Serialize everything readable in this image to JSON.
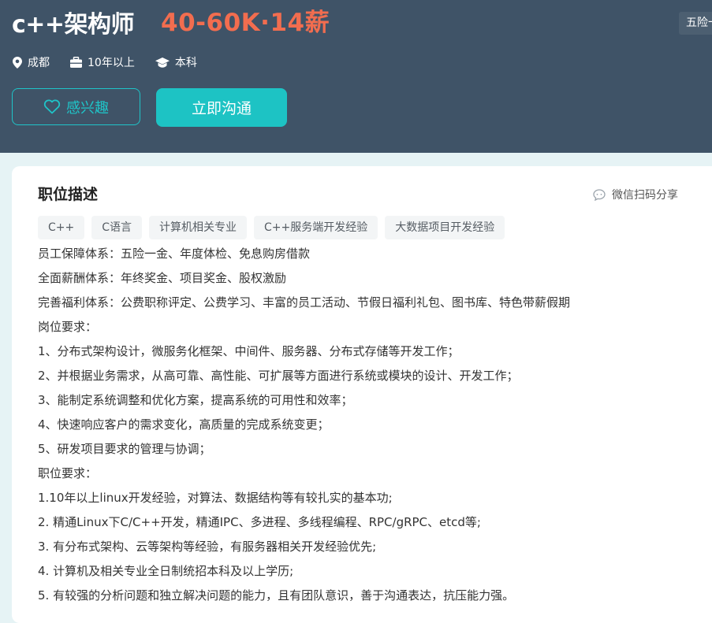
{
  "header": {
    "job_title": "c++架构师",
    "salary": "40-60K·14薪",
    "benefit_chip": "五险一金",
    "meta": {
      "location": "成都",
      "experience": "10年以上",
      "education": "本科"
    },
    "interest_button": "感兴趣",
    "chat_button": "立即沟通"
  },
  "colors": {
    "header_bg": "#3f5367",
    "salary": "#f26d4f",
    "accent": "#1dc3c4"
  },
  "icons": {
    "location": "location-pin-icon",
    "experience": "briefcase-icon",
    "education": "graduation-cap-icon",
    "interest": "heart-outline-icon",
    "share": "chat-bubble-icon"
  },
  "description": {
    "title": "职位描述",
    "share_label": "微信扫码分享",
    "tags": [
      "C++",
      "C语言",
      "计算机相关专业",
      "C++服务端开发经验",
      "大数据项目开发经验"
    ],
    "lines": [
      "员工保障体系：五险一金、年度体检、免息购房借款",
      "全面薪酬体系：年终奖金、项目奖金、股权激励",
      "完善福利体系：公费职称评定、公费学习、丰富的员工活动、节假日福利礼包、图书库、特色带薪假期",
      "岗位要求：",
      "1、分布式架构设计，微服务化框架、中间件、服务器、分布式存储等开发工作；",
      "2、并根据业务需求，从高可靠、高性能、可扩展等方面进行系统或模块的设计、开发工作；",
      "3、能制定系统调整和优化方案，提高系统的可用性和效率；",
      "4、快速响应客户的需求变化，高质量的完成系统变更；",
      "5、研发项目要求的管理与协调；",
      "职位要求：",
      "1.10年以上linux开发经验，对算法、数据结构等有较扎实的基本功;",
      "2. 精通Linux下C/C++开发，精通IPC、多进程、多线程编程、RPC/gRPC、etcd等;",
      "3. 有分布式架构、云等架构等经验，有服务器相关开发经验优先;",
      "4. 计算机及相关专业全日制统招本科及以上学历;",
      "5. 有较强的分析问题和独立解决问题的能力，且有团队意识，善于沟通表达，抗压能力强。"
    ]
  }
}
